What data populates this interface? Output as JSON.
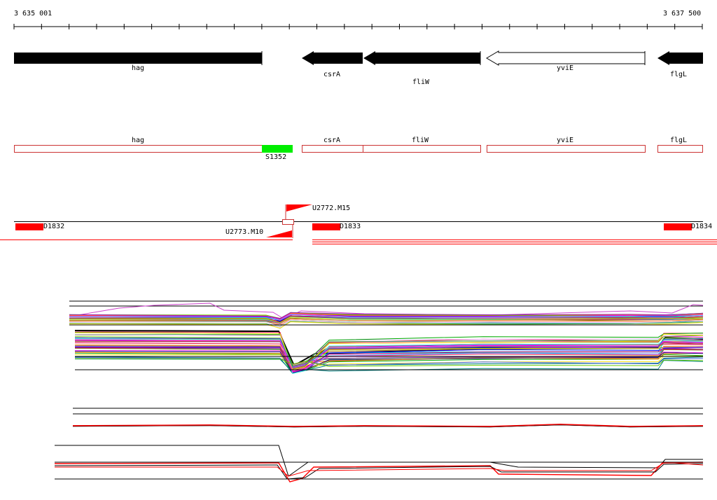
{
  "ruler": {
    "start_label": "3 635 001",
    "end_label": "3 637 500"
  },
  "genes": [
    {
      "name": "hag",
      "strand": "+",
      "fill": "#000000"
    },
    {
      "name": "csrA",
      "strand": "-",
      "fill": "#000000"
    },
    {
      "name": "fliW",
      "strand": "-",
      "fill": "#000000"
    },
    {
      "name": "yviE",
      "strand": "-",
      "fill": "#ffffff"
    },
    {
      "name": "flgL",
      "strand": "-",
      "fill": "#000000"
    }
  ],
  "annotations": [
    {
      "name": "hag"
    },
    {
      "name": "S1352",
      "fill": "#00ee00"
    },
    {
      "name": "csrA"
    },
    {
      "name": "fliW"
    },
    {
      "name": "yviE"
    },
    {
      "name": "flgL"
    }
  ],
  "segments": [
    {
      "name": "D1832"
    },
    {
      "name": "D1833"
    },
    {
      "name": "D1834"
    }
  ],
  "flags": [
    {
      "name": "U2772.M15"
    },
    {
      "name": "U2773.M10"
    }
  ],
  "colors": {
    "accent": "#ff0000",
    "annotation_outline": "#cc3333",
    "s_block": "#00ee00",
    "segment": "#ff0000"
  }
}
